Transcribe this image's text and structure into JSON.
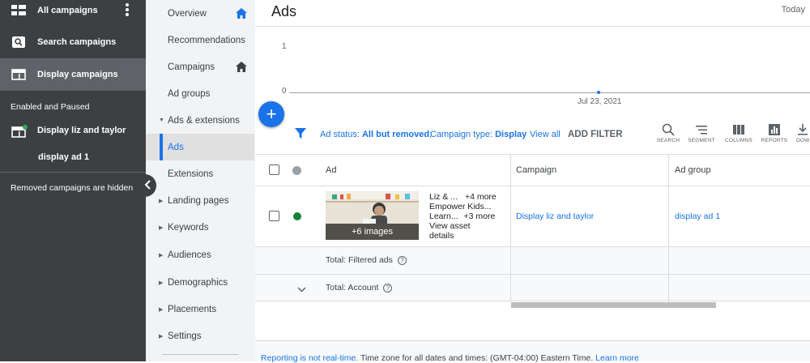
{
  "left_nav": {
    "items": [
      {
        "label": "All campaigns",
        "icon": "grid-icon"
      },
      {
        "label": "Search campaigns",
        "icon": "search-campaign-icon"
      },
      {
        "label": "Display campaigns",
        "icon": "display-icon"
      }
    ],
    "section_label": "Enabled and Paused",
    "campaign_label": "Display liz and taylor",
    "adgroup_label": "display ad 1",
    "hidden_note": "Removed campaigns are hidden"
  },
  "page_menu": {
    "items": [
      "Overview",
      "Recommendations",
      "Campaigns",
      "Ad groups",
      "Ads & extensions",
      "Ads",
      "Extensions",
      "Landing pages",
      "Keywords",
      "Audiences",
      "Demographics",
      "Placements",
      "Settings"
    ],
    "active": "Ads"
  },
  "main": {
    "title": "Ads",
    "date_range": "Today",
    "chart": {
      "y_ticks": [
        "1",
        "0"
      ],
      "x_label": "Jul 23, 2021"
    }
  },
  "filter_bar": {
    "status_label": "Ad status:",
    "status_value": "All but removed",
    "type_label": "Campaign type:",
    "type_value": "Display",
    "view_all": "View all",
    "add_filter": "ADD FILTER"
  },
  "toolbar": {
    "search": "SEARCH",
    "segment": "SEGMENT",
    "columns": "COLUMNS",
    "reports": "REPORTS",
    "download": "DOWNLOAD"
  },
  "table": {
    "headers": {
      "ad": "Ad",
      "campaign": "Campaign",
      "ad_group": "Ad group"
    },
    "row": {
      "image_caption": "+6 images",
      "line1": "Liz & ...",
      "line1_more": "+4 more",
      "line2": "Empower Kids...",
      "line3": "Learn...",
      "line3_more": "+3 more",
      "view_asset_1": "View asset",
      "view_asset_2": "details",
      "campaign": "Display liz and taylor",
      "ad_group": "display ad 1",
      "status_color": "#188038"
    },
    "total_filtered": "Total: Filtered ads",
    "total_account": "Total: Account"
  },
  "footer": {
    "link1": "Reporting is not real-time.",
    "text": " Time zone for all dates and times: (GMT-04:00) Eastern Time. ",
    "link2": "Learn more"
  }
}
